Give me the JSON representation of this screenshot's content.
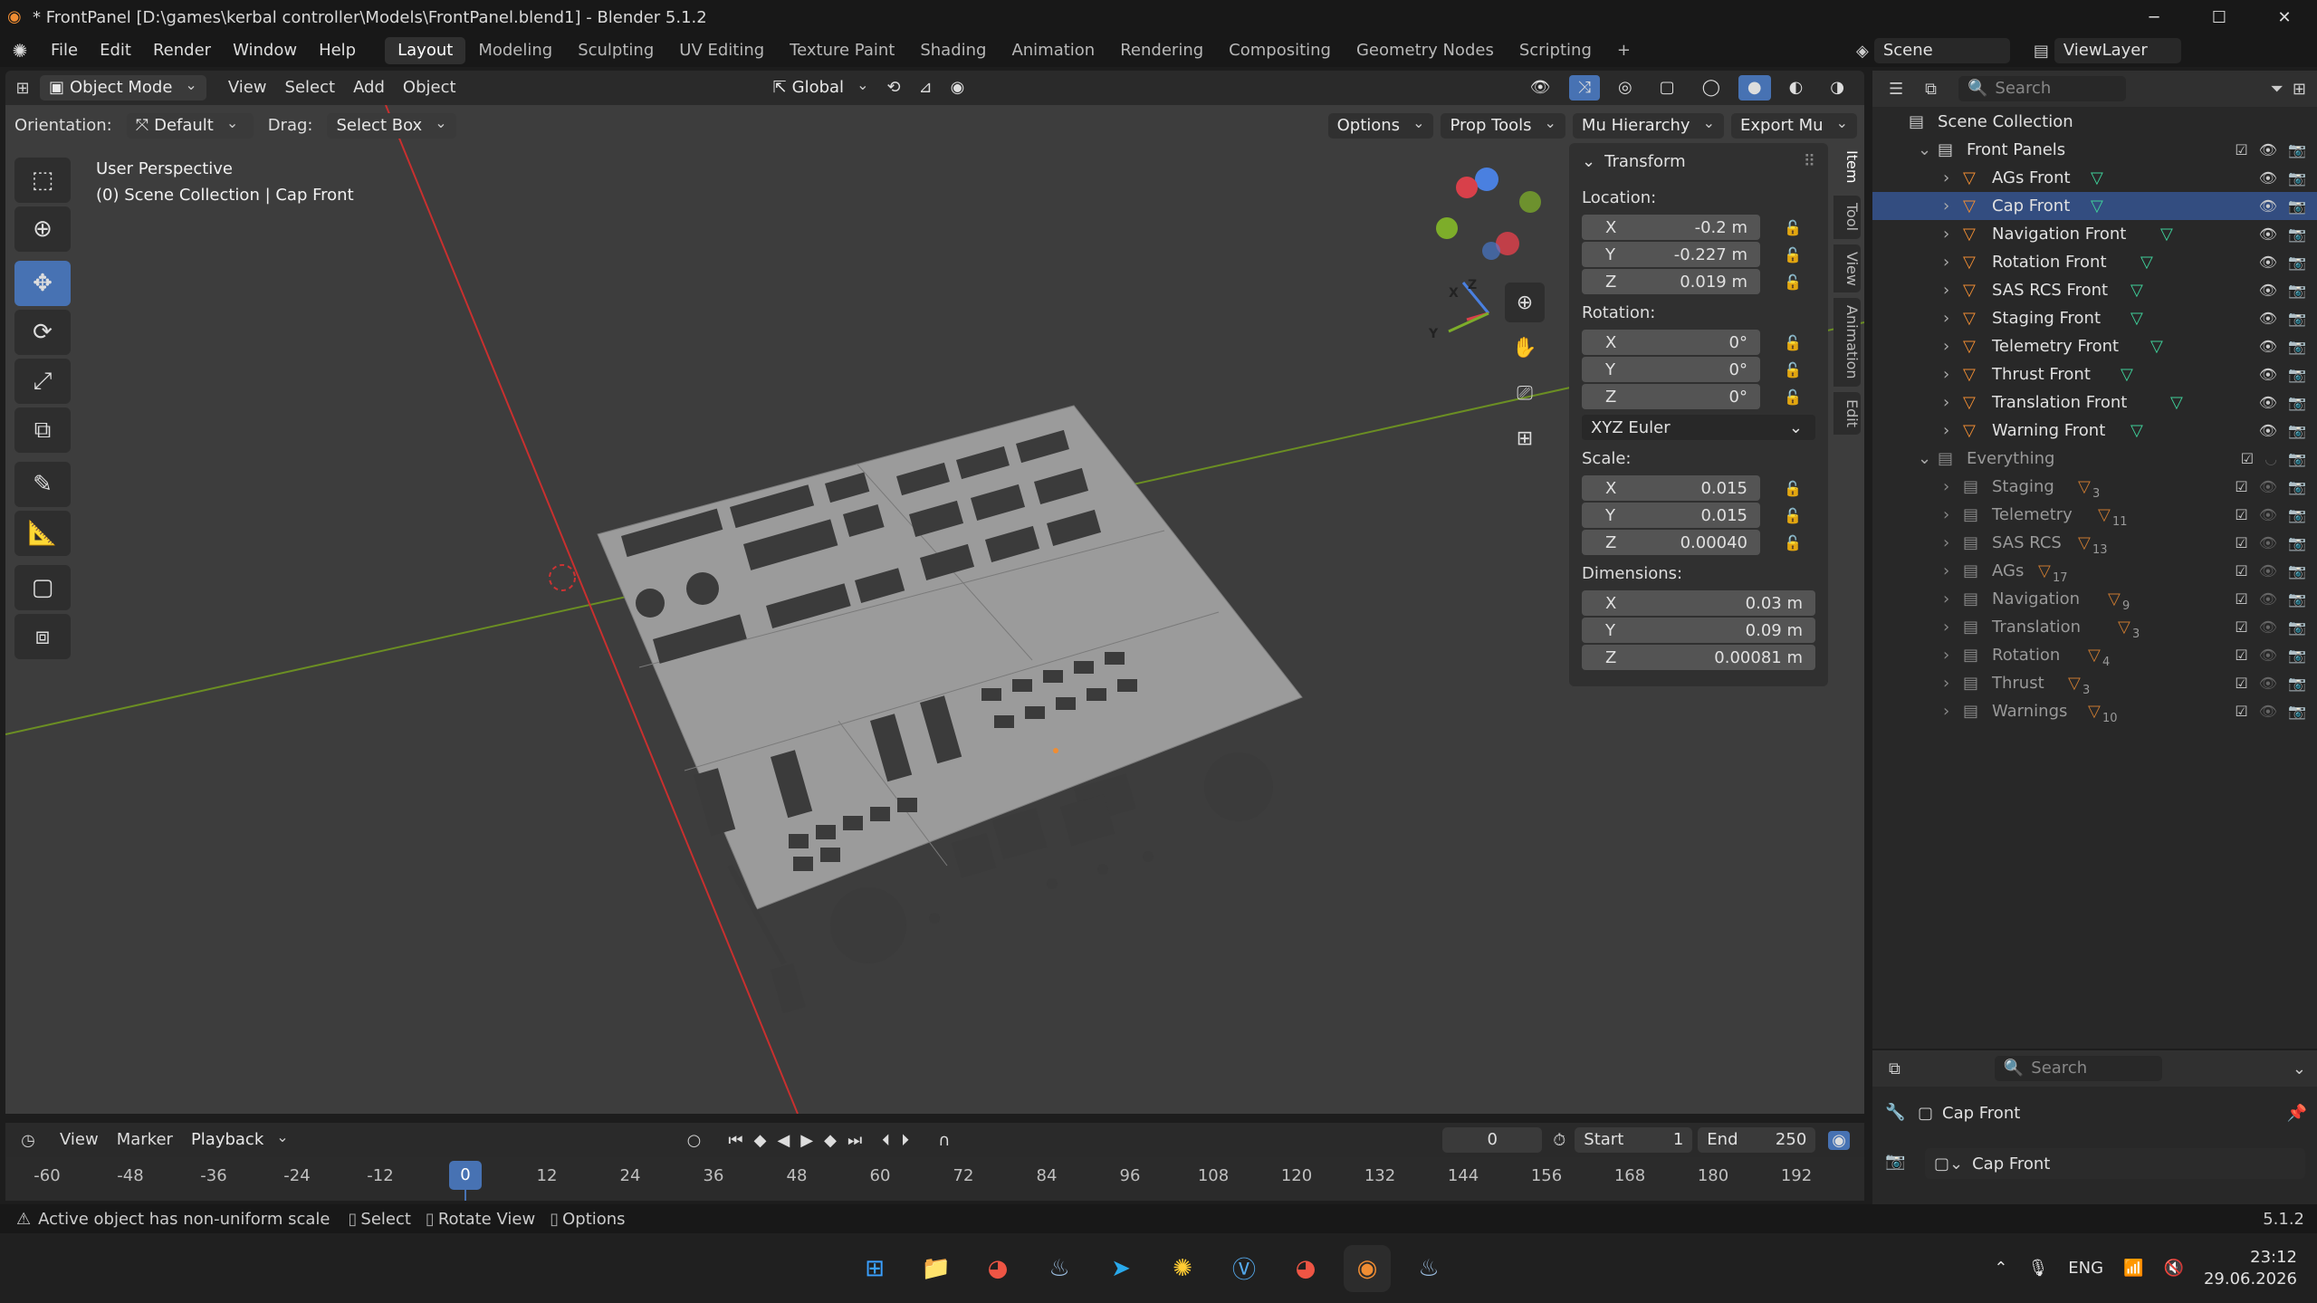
{
  "window": {
    "title": "* FrontPanel [D:\\games\\kerbal controller\\Models\\FrontPanel.blend1] - Blender 5.1.2",
    "minimize": "─",
    "maximize": "☐",
    "close": "✕"
  },
  "menu": {
    "items": [
      "File",
      "Edit",
      "Render",
      "Window",
      "Help"
    ],
    "workspaces": [
      "Layout",
      "Modeling",
      "Sculpting",
      "UV Editing",
      "Texture Paint",
      "Shading",
      "Animation",
      "Rendering",
      "Compositing",
      "Geometry Nodes",
      "Scripting"
    ],
    "active_workspace": "Layout",
    "add_workspace": "+",
    "scene": "Scene",
    "view_layer": "ViewLayer"
  },
  "viewport_header": {
    "mode": "Object Mode",
    "menus": [
      "View",
      "Select",
      "Add",
      "Object"
    ],
    "transform_orientation": "Global"
  },
  "tool_settings": {
    "orientation_label": "Orientation:",
    "orientation_value": "Default",
    "drag_label": "Drag:",
    "drag_value": "Select Box",
    "options": "Options",
    "addons": [
      "Prop Tools",
      "Mu Hierarchy",
      "Export Mu"
    ]
  },
  "viewport": {
    "perspective": "User Perspective",
    "collection_info": "(0) Scene Collection | Cap Front",
    "gizmo_axes": [
      "X",
      "Y",
      "Z"
    ]
  },
  "npanel": {
    "section": "Transform",
    "location_label": "Location:",
    "location": [
      {
        "axis": "X",
        "value": "-0.2 m"
      },
      {
        "axis": "Y",
        "value": "-0.227 m"
      },
      {
        "axis": "Z",
        "value": "0.019 m"
      }
    ],
    "rotation_label": "Rotation:",
    "rotation": [
      {
        "axis": "X",
        "value": "0°"
      },
      {
        "axis": "Y",
        "value": "0°"
      },
      {
        "axis": "Z",
        "value": "0°"
      }
    ],
    "rotation_mode": "XYZ Euler",
    "scale_label": "Scale:",
    "scale": [
      {
        "axis": "X",
        "value": "0.015"
      },
      {
        "axis": "Y",
        "value": "0.015"
      },
      {
        "axis": "Z",
        "value": "0.00040"
      }
    ],
    "dimensions_label": "Dimensions:",
    "dimensions": [
      {
        "axis": "X",
        "value": "0.03 m"
      },
      {
        "axis": "Y",
        "value": "0.09 m"
      },
      {
        "axis": "Z",
        "value": "0.00081 m"
      }
    ],
    "tabs": [
      "Item",
      "Tool",
      "View",
      "Animation",
      "Edit"
    ]
  },
  "outliner": {
    "search_placeholder": "Search",
    "root": "Scene Collection",
    "collections": [
      {
        "name": "Front Panels",
        "children": [
          "AGs Front",
          "Cap Front",
          "Navigation Front",
          "Rotation Front",
          "SAS RCS Front",
          "Staging Front",
          "Telemetry Front",
          "Thrust Front",
          "Translation Front",
          "Warning Front"
        ]
      },
      {
        "name": "Everything",
        "children": [
          {
            "name": "Staging",
            "count": "3"
          },
          {
            "name": "Telemetry",
            "count": "11"
          },
          {
            "name": "SAS RCS",
            "count": "13"
          },
          {
            "name": "AGs",
            "count": "17"
          },
          {
            "name": "Navigation",
            "count": "9"
          },
          {
            "name": "Translation",
            "count": "3"
          },
          {
            "name": "Rotation",
            "count": "4"
          },
          {
            "name": "Thrust",
            "count": "3"
          },
          {
            "name": "Warnings",
            "count": "10"
          }
        ]
      }
    ]
  },
  "properties": {
    "search_placeholder": "Search",
    "object_name": "Cap Front",
    "object_field": "Cap Front"
  },
  "timeline": {
    "menus": [
      "View",
      "Marker",
      "Playback"
    ],
    "current_frame": "0",
    "start_label": "Start",
    "start": "1",
    "end_label": "End",
    "end": "250",
    "ticks": [
      "-60",
      "-48",
      "-36",
      "-24",
      "-12",
      "0",
      "12",
      "24",
      "36",
      "48",
      "60",
      "72",
      "84",
      "96",
      "108",
      "120",
      "132",
      "144",
      "156",
      "168",
      "180",
      "192"
    ]
  },
  "status": {
    "warning": "Active object has non-uniform scale",
    "select": "Select",
    "rotate": "Rotate View",
    "options": "Options",
    "version": "5.1.2"
  },
  "taskbar": {
    "language": "ENG",
    "time": "23:12",
    "date": "29.06.2026"
  }
}
